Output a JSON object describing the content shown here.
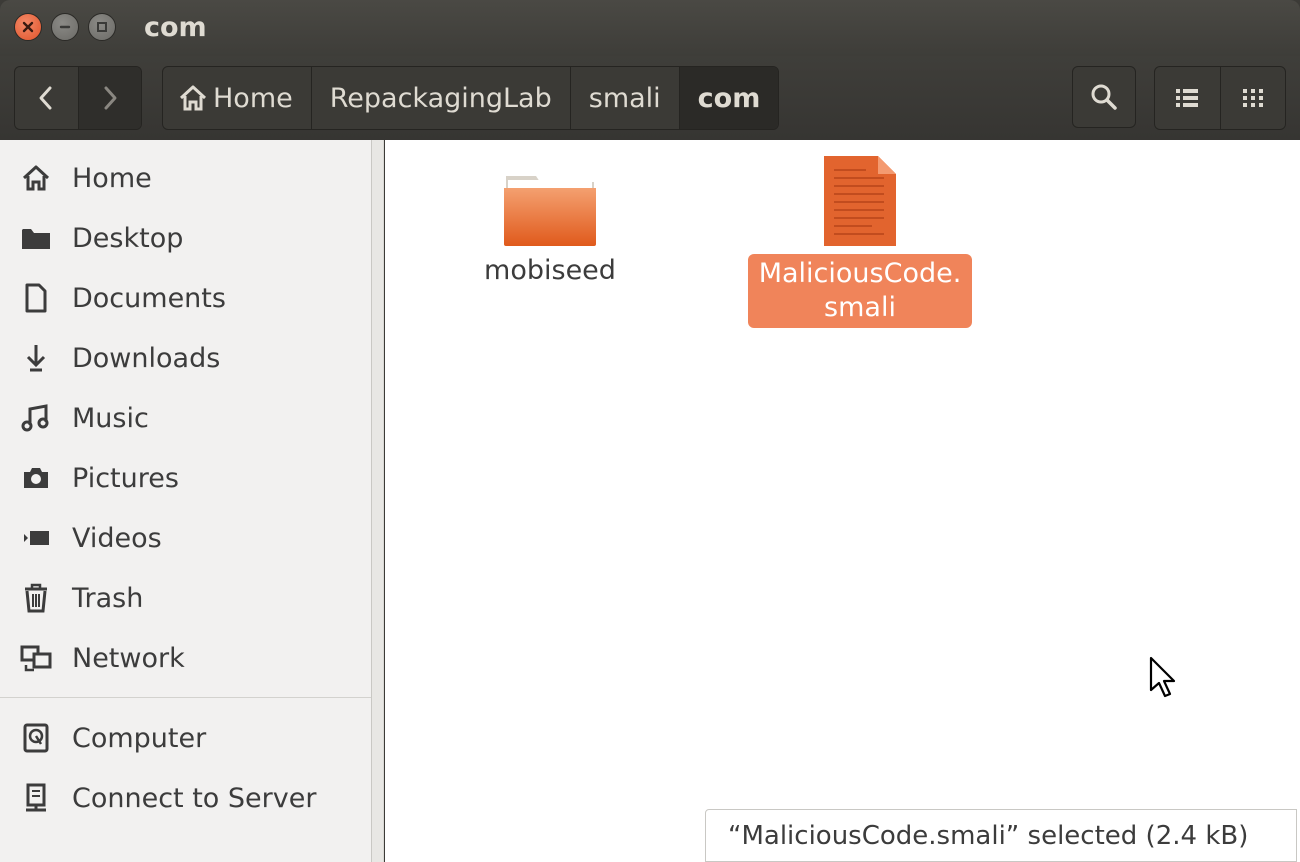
{
  "window": {
    "title": "com"
  },
  "breadcrumbs": [
    {
      "label": "Home"
    },
    {
      "label": "RepackagingLab"
    },
    {
      "label": "smali"
    },
    {
      "label": "com"
    }
  ],
  "sidebar": {
    "places": [
      {
        "label": "Home",
        "icon": "home-icon"
      },
      {
        "label": "Desktop",
        "icon": "folder-icon"
      },
      {
        "label": "Documents",
        "icon": "document-icon"
      },
      {
        "label": "Downloads",
        "icon": "download-icon"
      },
      {
        "label": "Music",
        "icon": "music-icon"
      },
      {
        "label": "Pictures",
        "icon": "camera-icon"
      },
      {
        "label": "Videos",
        "icon": "video-icon"
      },
      {
        "label": "Trash",
        "icon": "trash-icon"
      },
      {
        "label": "Network",
        "icon": "network-icon"
      }
    ],
    "devices": [
      {
        "label": "Computer",
        "icon": "computer-icon"
      },
      {
        "label": "Connect to Server",
        "icon": "server-icon"
      }
    ]
  },
  "files": [
    {
      "name": "mobiseed",
      "type": "folder",
      "selected": false
    },
    {
      "name_line1": "MaliciousCode.",
      "name_line2": "smali",
      "type": "text-file",
      "selected": true
    }
  ],
  "status": {
    "text": "“MaliciousCode.smali” selected  (2.4 kB)"
  },
  "colors": {
    "accent": "#f0845a",
    "titlebar": "#3c3b37",
    "sidebar": "#f2f1f0"
  }
}
